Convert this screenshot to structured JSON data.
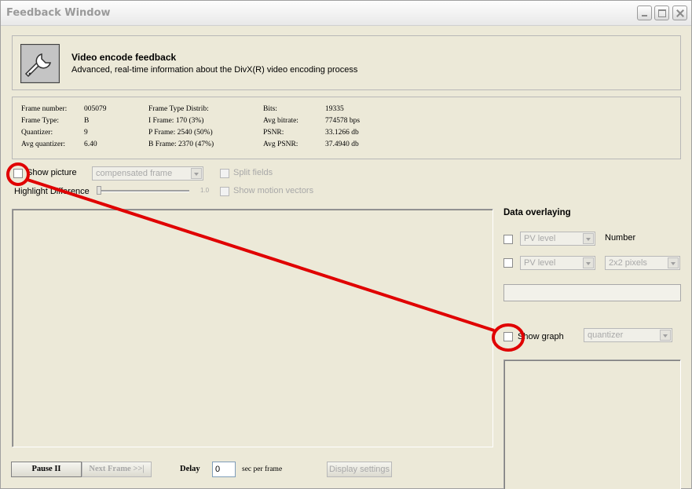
{
  "window": {
    "title": "Feedback Window"
  },
  "header": {
    "title": "Video encode feedback",
    "subtitle": "Advanced, real-time information about the DivX(R) video encoding process"
  },
  "stats": {
    "frame_number": {
      "label": "Frame number:",
      "value": "005079"
    },
    "frame_type": {
      "label": "Frame Type:",
      "value": "B"
    },
    "quantizer": {
      "label": "Quantizer:",
      "value": "9"
    },
    "avg_quantizer": {
      "label": "Avg quantizer:",
      "value": "6.40"
    },
    "distrib_title": "Frame Type Distrib:",
    "i_frame": "I Frame: 170 (3%)",
    "p_frame": "P Frame: 2540 (50%)",
    "b_frame": "B Frame: 2370 (47%)",
    "bits": {
      "label": "Bits:",
      "value": "19335"
    },
    "avg_bitrate": {
      "label": "Avg bitrate:",
      "value": "774578 bps"
    },
    "psnr": {
      "label": "PSNR:",
      "value": "33.1266 db"
    },
    "avg_psnr": {
      "label": "Avg PSNR:",
      "value": "37.4940 db"
    }
  },
  "picture_controls": {
    "show_picture": "Show picture",
    "picture_mode": "compensated frame",
    "split_fields": "Split fields",
    "highlight_difference": "Highlight Difference",
    "highlight_value": "1.0",
    "show_motion_vectors": "Show motion vectors"
  },
  "overlay": {
    "title": "Data overlaying",
    "row1_select": "PV level",
    "row1_label": "Number",
    "row2_select": "PV level",
    "row2_size": "2x2 pixels",
    "show_graph": "Show graph",
    "graph_select": "quantizer"
  },
  "bottom": {
    "pause": "Pause II",
    "next_frame": "Next Frame >>|",
    "delay_label": "Delay",
    "delay_value": "0",
    "delay_unit": "sec per frame",
    "display_settings": "Display settings"
  },
  "colors": {
    "annotation": "#e00000"
  }
}
